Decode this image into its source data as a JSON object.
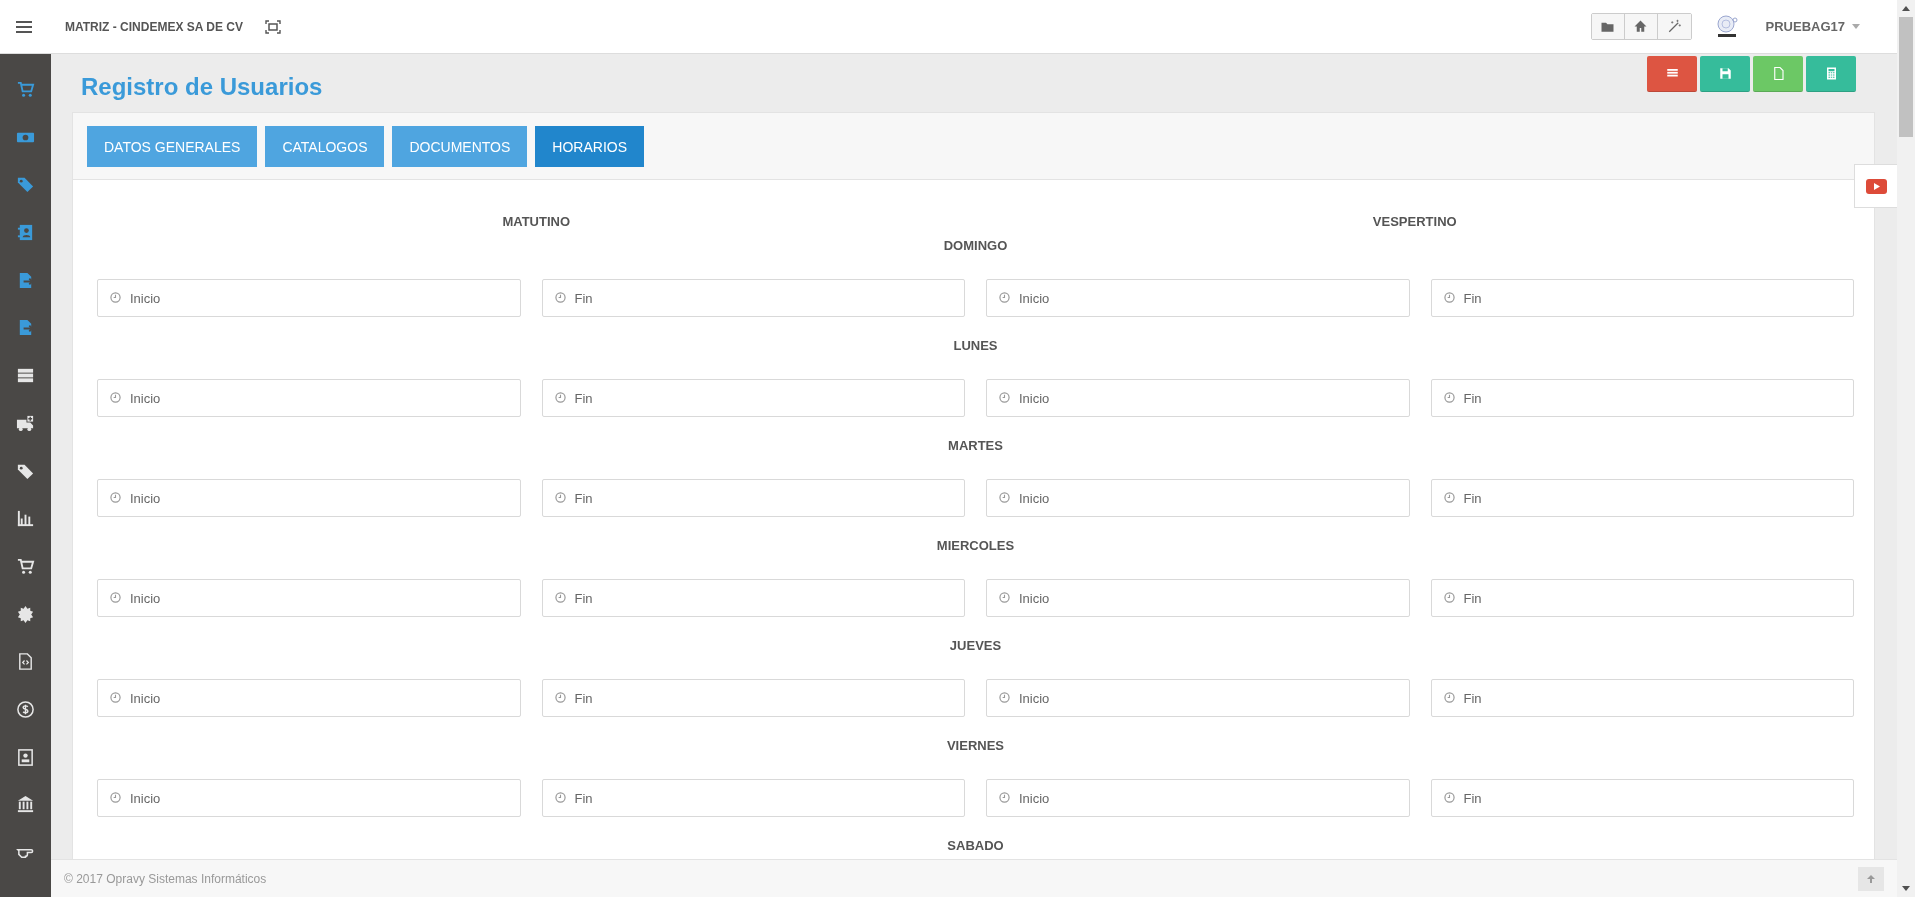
{
  "topbar": {
    "company": "MATRIZ - CINDEMEX SA DE CV",
    "tools": [
      {
        "kind": "folder"
      },
      {
        "kind": "home"
      },
      {
        "kind": "magic"
      }
    ],
    "user": "PRUEBAG17"
  },
  "sidebar": {
    "items": [
      {
        "kind": "cart",
        "color": "#3a9ad9"
      },
      {
        "kind": "money",
        "color": "#3a9ad9"
      },
      {
        "kind": "tags",
        "color": "#3a9ad9"
      },
      {
        "kind": "contacts",
        "color": "#3a9ad9"
      },
      {
        "kind": "export",
        "color": "#3a9ad9"
      },
      {
        "kind": "export",
        "color": "#3a9ad9"
      },
      {
        "kind": "server",
        "color": "#e6e6e6"
      },
      {
        "kind": "ambulance",
        "color": "#e6e6e6"
      },
      {
        "kind": "tags",
        "color": "#e6e6e6"
      },
      {
        "kind": "chart",
        "color": "#e6e6e6"
      },
      {
        "kind": "cart",
        "color": "#e6e6e6"
      },
      {
        "kind": "seal",
        "color": "#e6e6e6"
      },
      {
        "kind": "code",
        "color": "#e6e6e6"
      },
      {
        "kind": "dollar",
        "color": "#e6e6e6"
      },
      {
        "kind": "badge",
        "color": "#e6e6e6"
      },
      {
        "kind": "bank",
        "color": "#e6e6e6"
      },
      {
        "kind": "hand",
        "color": "#e6e6e6"
      }
    ]
  },
  "title": "Registro de Usuarios",
  "actions": [
    {
      "kind": "list",
      "color": "#dd5542"
    },
    {
      "kind": "save",
      "color": "#36bc9b"
    },
    {
      "kind": "new",
      "color": "#6cc865"
    },
    {
      "kind": "calc",
      "color": "#36bc9b"
    }
  ],
  "tabs": [
    {
      "label": "DATOS GENERALES",
      "selected": false
    },
    {
      "label": "CATALOGOS",
      "selected": false
    },
    {
      "label": "DOCUMENTOS",
      "selected": false
    },
    {
      "label": "HORARIOS",
      "selected": true
    }
  ],
  "shifts": [
    "MATUTINO",
    "VESPERTINO"
  ],
  "days": [
    {
      "name": "DOMINGO",
      "fields": [
        {
          "placeholder": "Inicio"
        },
        {
          "placeholder": "Fin"
        },
        {
          "placeholder": "Inicio"
        },
        {
          "placeholder": "Fin"
        }
      ]
    },
    {
      "name": "LUNES",
      "fields": [
        {
          "placeholder": "Inicio"
        },
        {
          "placeholder": "Fin"
        },
        {
          "placeholder": "Inicio"
        },
        {
          "placeholder": "Fin"
        }
      ]
    },
    {
      "name": "MARTES",
      "fields": [
        {
          "placeholder": "Inicio"
        },
        {
          "placeholder": "Fin"
        },
        {
          "placeholder": "Inicio"
        },
        {
          "placeholder": "Fin"
        }
      ]
    },
    {
      "name": "MIERCOLES",
      "fields": [
        {
          "placeholder": "Inicio"
        },
        {
          "placeholder": "Fin"
        },
        {
          "placeholder": "Inicio"
        },
        {
          "placeholder": "Fin"
        }
      ]
    },
    {
      "name": "JUEVES",
      "fields": [
        {
          "placeholder": "Inicio"
        },
        {
          "placeholder": "Fin"
        },
        {
          "placeholder": "Inicio"
        },
        {
          "placeholder": "Fin"
        }
      ]
    },
    {
      "name": "VIERNES",
      "fields": [
        {
          "placeholder": "Inicio"
        },
        {
          "placeholder": "Fin"
        },
        {
          "placeholder": "Inicio"
        },
        {
          "placeholder": "Fin"
        }
      ]
    },
    {
      "name": "SABADO"
    }
  ],
  "footer": "© 2017 Opravy Sistemas Informáticos"
}
